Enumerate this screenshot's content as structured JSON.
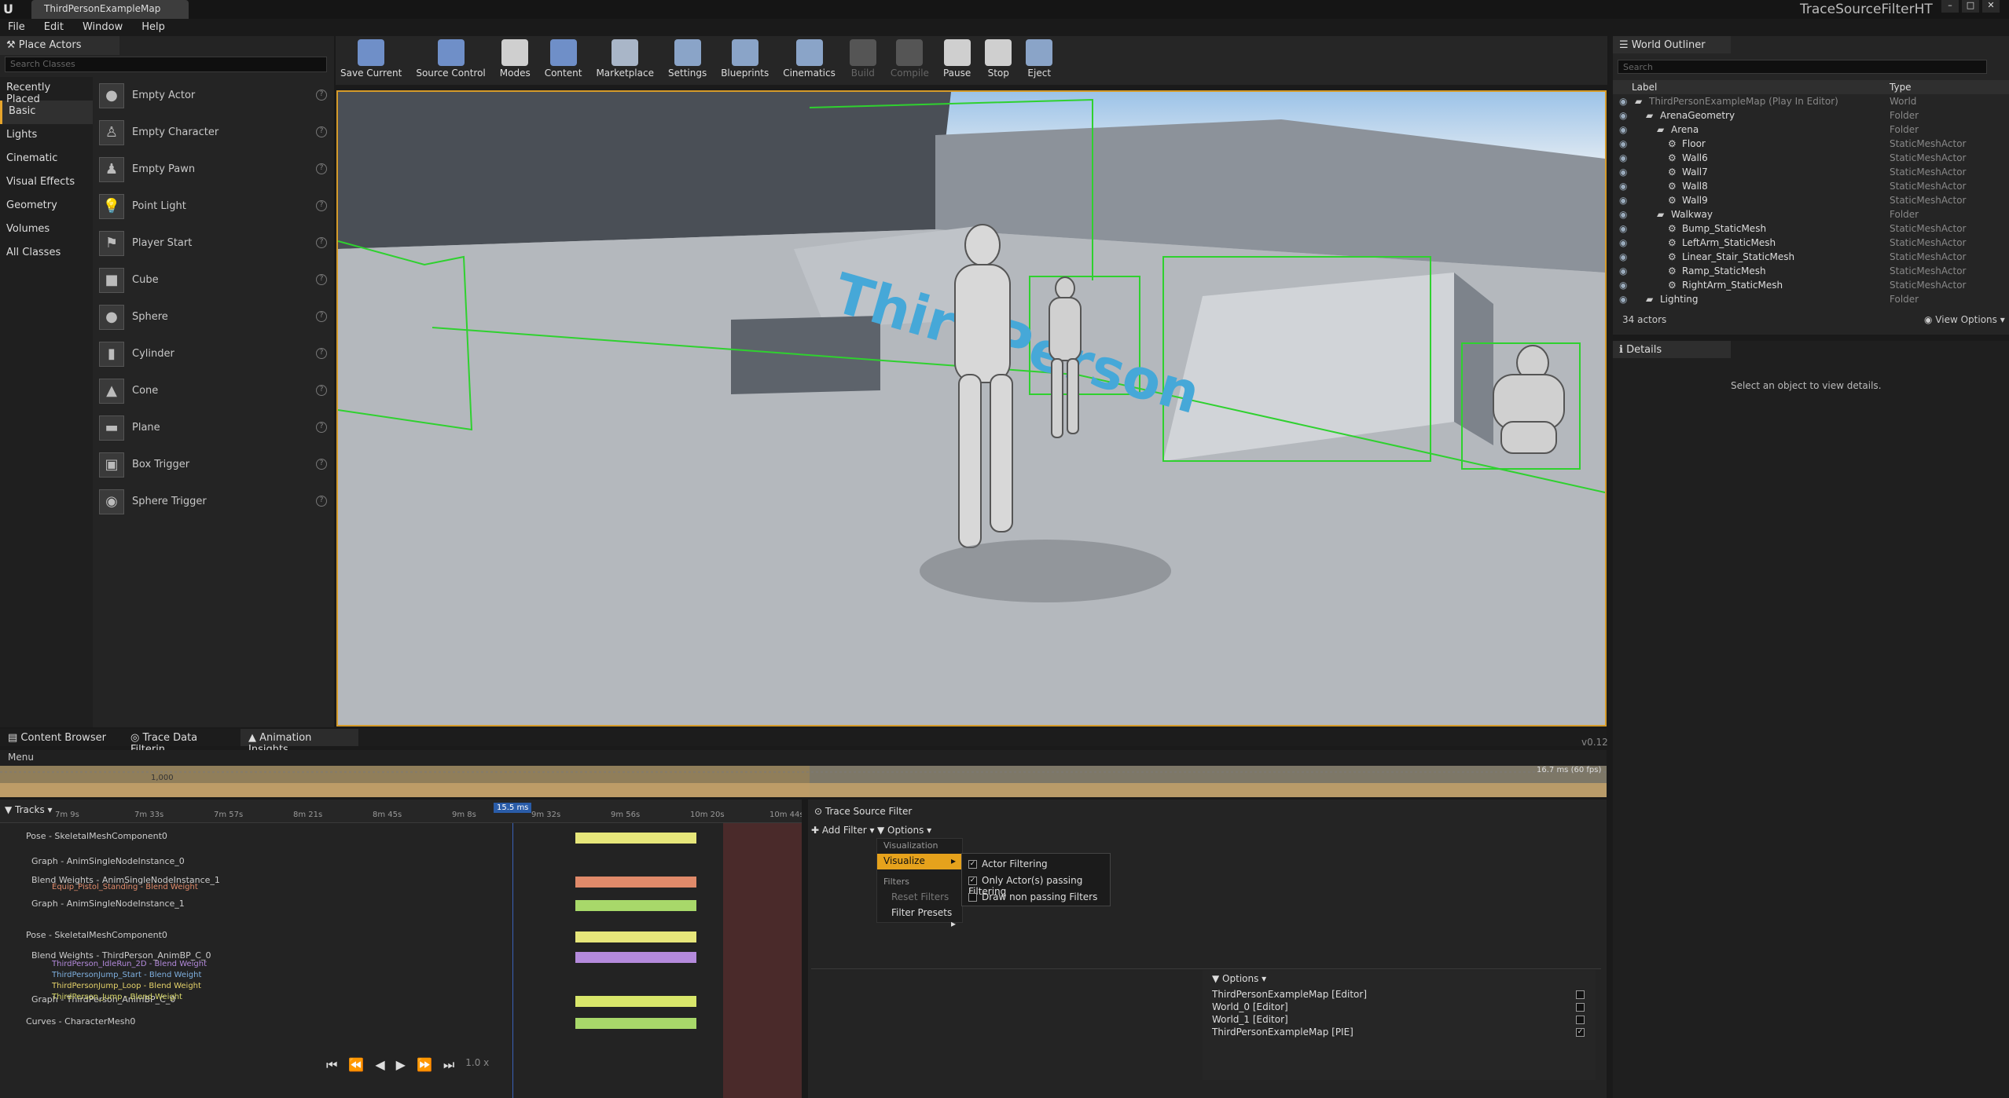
{
  "window": {
    "tab_title": "ThirdPersonExampleMap",
    "trace_title": "TraceSourceFilterHT"
  },
  "menu": [
    "File",
    "Edit",
    "Window",
    "Help"
  ],
  "place_actors": {
    "tab": "Place Actors",
    "search_placeholder": "Search Classes",
    "categories": [
      "Recently Placed",
      "Basic",
      "Lights",
      "Cinematic",
      "Visual Effects",
      "Geometry",
      "Volumes",
      "All Classes"
    ],
    "actors": [
      "Empty Actor",
      "Empty Character",
      "Empty Pawn",
      "Point Light",
      "Player Start",
      "Cube",
      "Sphere",
      "Cylinder",
      "Cone",
      "Plane",
      "Box Trigger",
      "Sphere Trigger"
    ]
  },
  "toolbar": [
    {
      "label": "Save Current",
      "icon": "save-icon",
      "color": "#6f8fc8"
    },
    {
      "label": "Source Control",
      "icon": "source-control-icon",
      "color": "#6f8fc8"
    },
    {
      "label": "Modes",
      "icon": "modes-icon",
      "color": "#cfcfcf"
    },
    {
      "label": "Content",
      "icon": "content-icon",
      "color": "#6f8fc8"
    },
    {
      "label": "Marketplace",
      "icon": "marketplace-icon",
      "color": "#a9b6c8"
    },
    {
      "label": "Settings",
      "icon": "settings-icon",
      "color": "#8aa4c8"
    },
    {
      "label": "Blueprints",
      "icon": "blueprints-icon",
      "color": "#8aa4c8"
    },
    {
      "label": "Cinematics",
      "icon": "cinematics-icon",
      "color": "#8aa4c8"
    },
    {
      "label": "Build",
      "icon": "build-icon",
      "color": "#555555"
    },
    {
      "label": "Compile",
      "icon": "compile-icon",
      "color": "#555555"
    },
    {
      "label": "Pause",
      "icon": "pause-icon",
      "color": "#cfcfcf"
    },
    {
      "label": "Stop",
      "icon": "stop-icon",
      "color": "#cfcfcf"
    },
    {
      "label": "Eject",
      "icon": "eject-icon",
      "color": "#8aa4c8"
    }
  ],
  "viewport": {
    "floor_text": "ThirdPerson"
  },
  "outliner": {
    "tab": "World Outliner",
    "search_placeholder": "Search",
    "col_label": "Label",
    "col_type": "Type",
    "rows": [
      {
        "label": "ThirdPersonExampleMap (Play In Editor)",
        "type": "World",
        "indent": 0
      },
      {
        "label": "ArenaGeometry",
        "type": "Folder",
        "indent": 1
      },
      {
        "label": "Arena",
        "type": "Folder",
        "indent": 2
      },
      {
        "label": "Floor",
        "type": "StaticMeshActor",
        "indent": 3
      },
      {
        "label": "Wall6",
        "type": "StaticMeshActor",
        "indent": 3
      },
      {
        "label": "Wall7",
        "type": "StaticMeshActor",
        "indent": 3
      },
      {
        "label": "Wall8",
        "type": "StaticMeshActor",
        "indent": 3
      },
      {
        "label": "Wall9",
        "type": "StaticMeshActor",
        "indent": 3
      },
      {
        "label": "Walkway",
        "type": "Folder",
        "indent": 2
      },
      {
        "label": "Bump_StaticMesh",
        "type": "StaticMeshActor",
        "indent": 3
      },
      {
        "label": "LeftArm_StaticMesh",
        "type": "StaticMeshActor",
        "indent": 3
      },
      {
        "label": "Linear_Stair_StaticMesh",
        "type": "StaticMeshActor",
        "indent": 3
      },
      {
        "label": "Ramp_StaticMesh",
        "type": "StaticMeshActor",
        "indent": 3
      },
      {
        "label": "RightArm_StaticMesh",
        "type": "StaticMeshActor",
        "indent": 3
      },
      {
        "label": "Lighting",
        "type": "Folder",
        "indent": 1
      }
    ],
    "actor_count": "34 actors",
    "view_options": "View Options"
  },
  "details": {
    "tab": "Details",
    "message": "Select an object to view details."
  },
  "bottom_tabs": [
    "Content Browser",
    "Trace Data Filterin",
    "Animation Insights"
  ],
  "version": "v0.12",
  "timeline": {
    "menu": "Menu",
    "histogram_labels": [
      "1,000",
      "16.7 ms (60 fps)"
    ],
    "tracks_label": "Tracks",
    "times": [
      "7m 9s",
      "7m 33s",
      "7m 57s",
      "8m 21s",
      "8m 45s",
      "9m 8s",
      "9m 32s",
      "9m 56s",
      "10m 20s",
      "10m 44s"
    ],
    "cursor_time": "15.5 ms",
    "tracks": [
      {
        "label": "Pose - SkeletalMeshComponent0",
        "x": 33,
        "color": "#e6e67a"
      },
      {
        "label": "Graph - AnimSingleNodeInstance_0",
        "x": 40,
        "color": ""
      },
      {
        "label": "Blend Weights - AnimSingleNodeInstance_1",
        "x": 40,
        "color": "#e08a6a"
      },
      {
        "label": "Graph - AnimSingleNodeInstance_1",
        "x": 40,
        "color": "#a8d86a"
      },
      {
        "label": "Pose - SkeletalMeshComponent0",
        "x": 33,
        "color": "#e6e67a"
      },
      {
        "label": "Blend Weights - ThirdPerson_AnimBP_C_0",
        "x": 40,
        "color": "#b48adc"
      },
      {
        "label": "Graph - ThirdPerson_AnimBP_C_0",
        "x": 40,
        "color": "#d8e66a"
      },
      {
        "label": "Curves - CharacterMesh0",
        "x": 33,
        "color": "#a8d86a"
      }
    ],
    "sub_labels": [
      {
        "text": "Equip_Pistol_Standing - Blend Weight",
        "color": "#e08a6a"
      },
      {
        "text": "ThirdPerson_IdleRun_2D - Blend Weight",
        "color": "#b48adc"
      },
      {
        "text": "ThirdPersonJump_Start - Blend Weight",
        "color": "#7fb0e0"
      },
      {
        "text": "ThirdPersonJump_Loop - Blend Weight",
        "color": "#e6d36a"
      },
      {
        "text": "ThirdPerson_Jump - Blend Weight",
        "color": "#d8d86a"
      }
    ],
    "speed": "1.0 x"
  },
  "trace_source_filter": {
    "title": "Trace Source Filter",
    "add_filter": "Add Filter",
    "options": "Options",
    "visualization_header": "Visualization",
    "visualize": "Visualize",
    "filters_header": "Filters",
    "reset_filters": "Reset Filters",
    "filter_presets": "Filter Presets",
    "vis_options": [
      {
        "label": "Actor Filtering",
        "checked": true
      },
      {
        "label": "Only Actor(s) passing Filtering",
        "checked": true
      },
      {
        "label": "Draw non passing Filters",
        "checked": false
      }
    ],
    "worlds_options": "Options",
    "worlds": [
      {
        "label": "ThirdPersonExampleMap [Editor]",
        "checked": false
      },
      {
        "label": "World_0 [Editor]",
        "checked": false
      },
      {
        "label": "World_1 [Editor]",
        "checked": false
      },
      {
        "label": "ThirdPersonExampleMap [PIE]",
        "checked": true
      }
    ]
  }
}
